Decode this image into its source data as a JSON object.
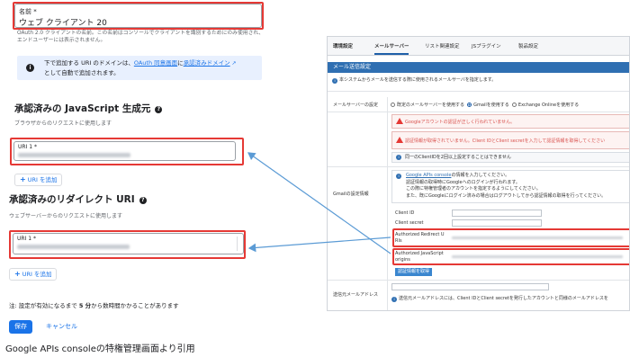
{
  "left": {
    "name_field": {
      "label": "名前 *",
      "value": "ウェブ クライアント 20"
    },
    "name_help": [
      "OAuth 2.0 クライアントの名前。この名前はコンソールでクライアントを識別するためにのみ使用され、エンドユーザーには表示されません。"
    ],
    "info": {
      "line1_prefix": "下で追加する URI のドメインは、",
      "link1": "OAuth 同意画面",
      "line1_mid": "に",
      "link2": "承認済みドメイン",
      "line2": "として自動で追加されます。"
    },
    "js_origins": {
      "title": "承認済みの JavaScript 生成元",
      "help": "ブラウザからのリクエストに使用します",
      "uri_label": "URI 1 *",
      "add_label": "URI を追加"
    },
    "redirect": {
      "title": "承認済みのリダイレクト URI",
      "help": "ウェブサーバーからのリクエストに使用します",
      "uri_label": "URI 1 *",
      "add_label": "URI を追加"
    },
    "note": {
      "prefix": "注: 設定が有効になるまで ",
      "bold": "5 分",
      "suffix": "から数時間かかることがあります"
    },
    "save_label": "保存",
    "cancel_label": "キャンセル"
  },
  "right": {
    "tabs": [
      "環境設定",
      "メールサーバー",
      "リスト関連設定",
      "JSプラグイン",
      "製品設定"
    ],
    "active_tab": "メールサーバー",
    "section_header": "メール送信設定",
    "description": "本システムからメールを送信する際に使用されるメールサーバを指定します。",
    "mail_server_label": "メールサーバーの設定",
    "radio_options": [
      {
        "label": "既定のメールサーバーを使用する",
        "selected": false
      },
      {
        "label": "Gmailを使用する",
        "selected": true
      },
      {
        "label": "Exchange Onlineを使用する",
        "selected": false
      }
    ],
    "warnings": [
      "Googleアカウントの認証が正しく行われていません。",
      "認証情報が取得されていません。Client IDとClient secretを入力して認証情報を取得してください"
    ],
    "notice": "同一のClientIDを2回以上設定することはできません",
    "gmail_label": "Gmailの設定情報",
    "gmail_intro": [
      "Google APIs consoleの情報を入力してください。",
      "認証情報の取得時にGoogleへのログインが行われます。",
      "この際に特権管理者のアカウントを指定するようにしてください。",
      "また、既にGoogleにログイン済みの場合はログアウトしてから認証情報の取得を行ってください。"
    ],
    "gmail_intro_link": "Google APIs console",
    "client_id_label": "Client ID",
    "client_secret_label": "Client secret",
    "redirect_label": [
      "Authorized Redirect U",
      "RIs"
    ],
    "js_origin_label": [
      "Authorized JavaScript",
      "origins"
    ],
    "get_auth_button": "認証情報を取得",
    "sender_label": "送信元メールアドレス",
    "sender_note": "送信元メールアドレスには、Client IDとClient secretを発行したアカウントと同様のメールアドレスを"
  },
  "caption": "Google APIs consoleの特権管理画面より引用",
  "colors": {
    "accent": "#1a73e8",
    "highlight": "#e53935",
    "header": "#2f6fb2",
    "arrow": "#5b9bd5"
  }
}
